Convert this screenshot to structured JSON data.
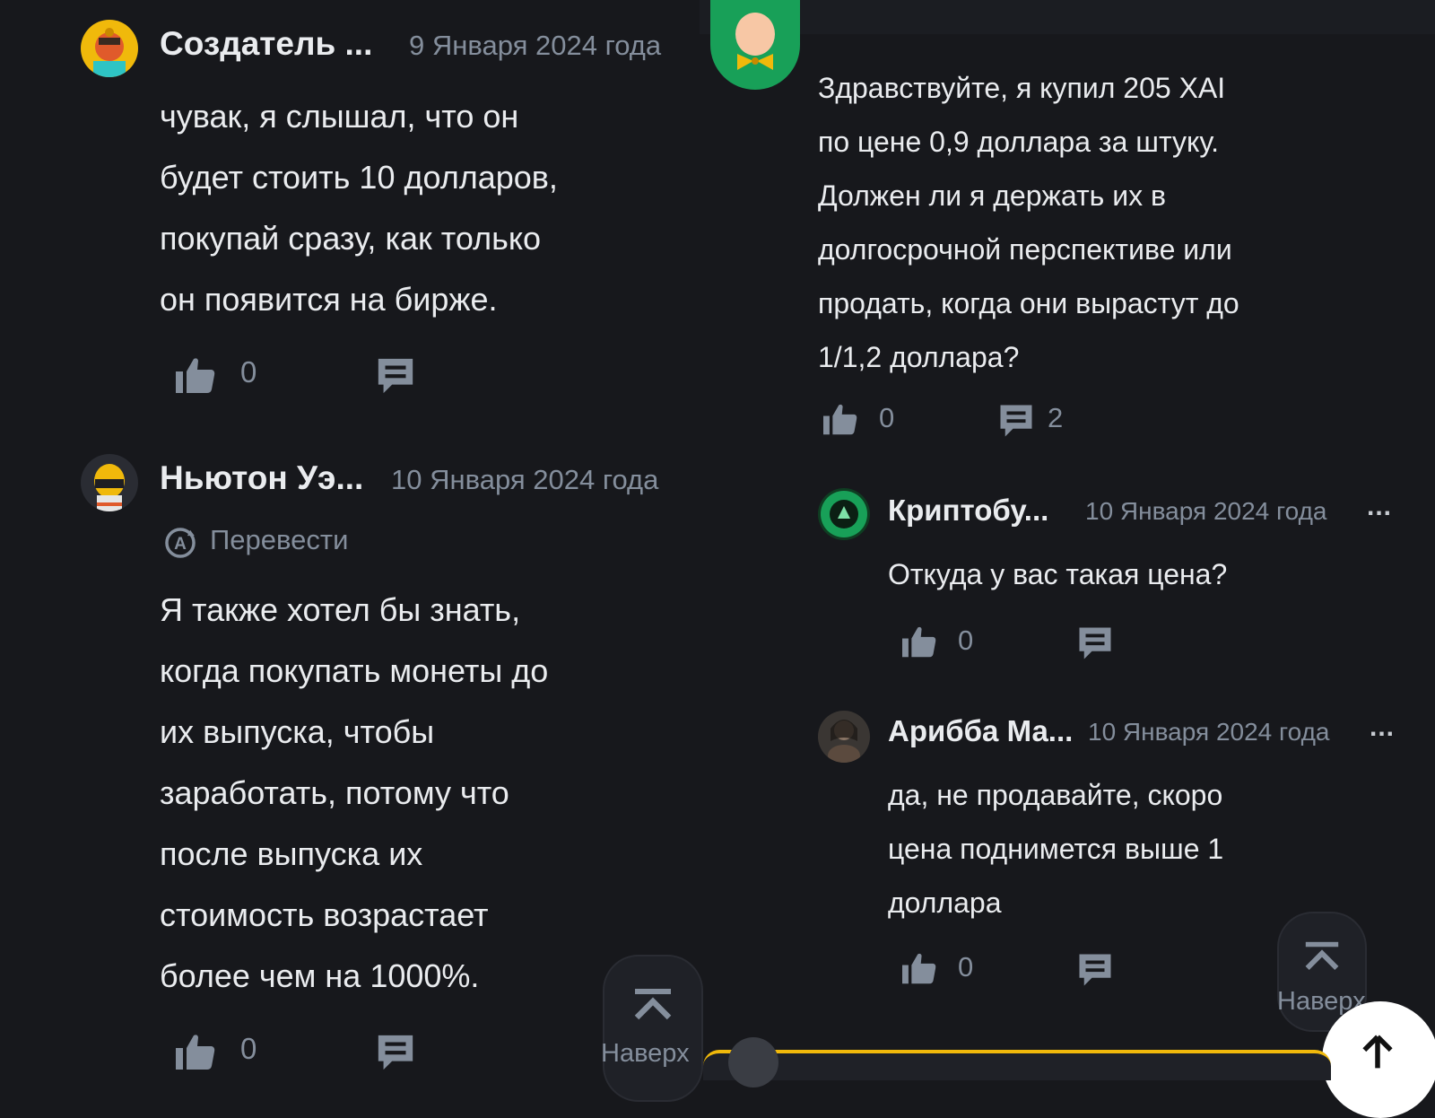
{
  "colors": {
    "background": "#17181c",
    "text": "#eaecef",
    "muted": "#848e9c",
    "accent": "#f0b90b",
    "success": "#18a058"
  },
  "left_column": {
    "comments": [
      {
        "author": "Создатель ...",
        "date": "9 Января 2024 года",
        "text": "чувак, я слышал, что он\nбудет стоить 10 долларов,\nпокупай сразу, как только\nон появится на бирже.",
        "likes": "0",
        "avatar_icon": "astronaut-avatar-icon"
      },
      {
        "author": "Ньютон Уэ...",
        "date": "10 Января 2024 года",
        "translate_label": "Перевести",
        "text": "Я также хотел бы знать,\nкогда покупать монеты до\nих выпуска, чтобы\nзаработать, потому что\nпосле выпуска их\nстоимость возрастает\nболее чем на 1000%.",
        "likes": "0",
        "avatar_icon": "astronaut-avatar-icon"
      }
    ],
    "scroll_top_label": "Наверх"
  },
  "right_column": {
    "main_comment": {
      "text": "Здравствуйте, я купил 205 XAI\nпо цене 0,9 доллара за штуку.\nДолжен ли я держать их в\nдолгосрочной перспективе или\nпродать, когда они вырастут до\n1/1,2 доллара?",
      "likes": "0",
      "replies": "2",
      "avatar_icon": "bowtie-avatar-icon"
    },
    "replies": [
      {
        "author": "Криптобу...",
        "date": "10 Января 2024 года",
        "text": "Откуда у вас такая цена?",
        "likes": "0",
        "avatar_icon": "crypto-logo-avatar-icon"
      },
      {
        "author": "Арибба Ма...",
        "date": "10 Января 2024 года",
        "text": "да, не продавайте, скоро\nцена поднимется выше 1\nдоллара",
        "likes": "0",
        "avatar_icon": "photo-avatar-icon"
      }
    ],
    "scroll_top_label": "Наверх"
  },
  "more_label": "..."
}
